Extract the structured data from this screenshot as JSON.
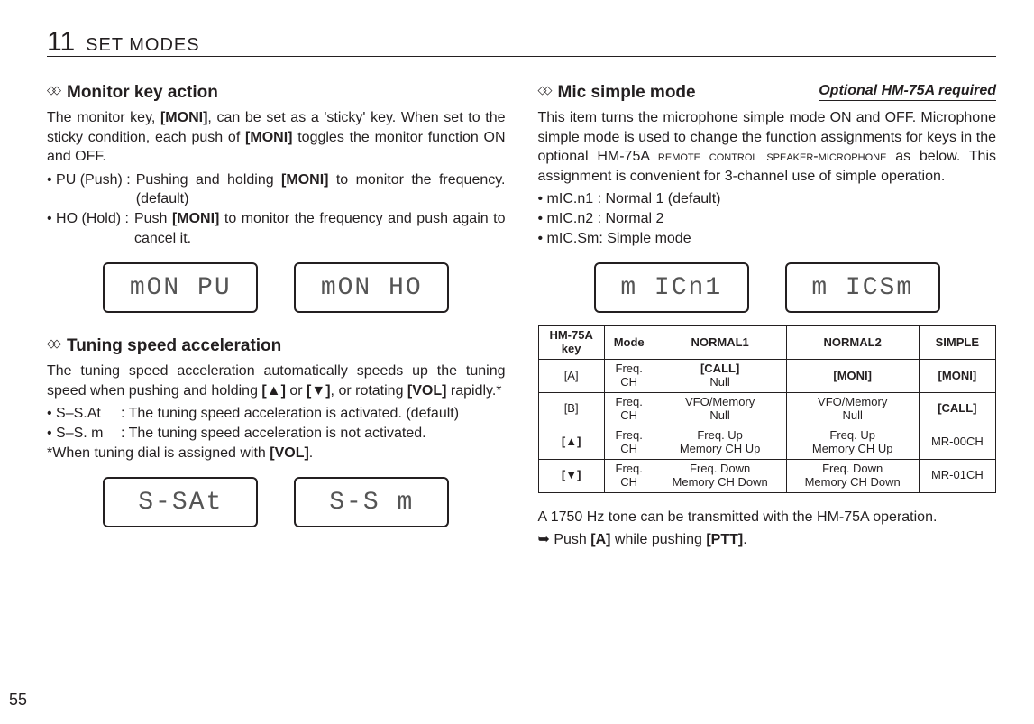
{
  "header": {
    "secnum": "11",
    "sectitle": "SET MODES"
  },
  "page_number": "55",
  "left": {
    "s1": {
      "diamond": "◇◇",
      "title": "Monitor key action",
      "p1a": "The monitor key, ",
      "p1b": "[MONI]",
      "p1c": ", can be set as a 'sticky' key. When set to the sticky condition, each push of ",
      "p1d": "[MONI]",
      "p1e": " toggles the monitor function ON and OFF.",
      "b1k": "• PU (Push) :",
      "b1va": "Pushing and holding ",
      "b1vb": "[MONI]",
      "b1vc": " to monitor the frequency. (default)",
      "b2k": "• HO (Hold) :",
      "b2va": "Push ",
      "b2vb": "[MONI]",
      "b2vc": " to monitor the frequency and push again to cancel it.",
      "lcd1": "mON PU",
      "lcd2": "mON HO"
    },
    "s2": {
      "diamond": "◇◇",
      "title": "Tuning speed acceleration",
      "p1a": "The tuning speed acceleration automatically speeds up the tuning speed when pushing and holding ",
      "p1b": "[▲]",
      "p1c": " or ",
      "p1d": "[▼]",
      "p1e": ", or rotating ",
      "p1f": "[VOL]",
      "p1g": " rapidly.*",
      "b1k": "• S–S.At",
      "b1v": ": The tuning speed acceleration is activated. (default)",
      "b2k": "• S–S. m",
      "b2v": ": The tuning speed acceleration is not activated.",
      "note_a": "*When tuning dial is assigned with ",
      "note_b": "[VOL]",
      "note_c": ".",
      "lcd1": "S-SAt",
      "lcd2": "S-S m"
    }
  },
  "right": {
    "s1": {
      "diamond": "◇◇",
      "title": "Mic simple mode",
      "rightnote": "Optional HM-75A required",
      "p1a": "This item turns the microphone simple mode ON and OFF. Microphone simple mode is used to change the function assignments for keys in the optional HM-75A ",
      "p1b": "remote control speaker-microphone",
      "p1c": " as below. This assignment is convenient for 3-channel use of simple operation.",
      "b1": "• mIC.n1 : Normal 1 (default)",
      "b2": "• mIC.n2 : Normal 2",
      "b3": "• mIC.Sm: Simple mode",
      "lcd1": "m ICn1",
      "lcd2": "m ICSm"
    },
    "table": {
      "h_key1": "HM-75A",
      "h_key2": "key",
      "h_mode": "Mode",
      "h_n1": "NORMAL1",
      "h_n2": "NORMAL2",
      "h_sm": "SIMPLE",
      "rows": [
        {
          "k": "[A]",
          "m1": "Freq.",
          "m2": "CH",
          "n1a": "[CALL]",
          "n1b": "Null",
          "n2": "[MONI]",
          "sm": "[MONI]"
        },
        {
          "k": "[B]",
          "m1": "Freq.",
          "m2": "CH",
          "n1a": "VFO/Memory",
          "n1b": "Null",
          "n2a": "VFO/Memory",
          "n2b": "Null",
          "sm": "[CALL]"
        },
        {
          "k": "[▲]",
          "m1": "Freq.",
          "m2": "CH",
          "n1a": "Freq. Up",
          "n1b": "Memory CH Up",
          "n2a": "Freq. Up",
          "n2b": "Memory CH Up",
          "sm": "MR-00CH"
        },
        {
          "k": "[▼]",
          "m1": "Freq.",
          "m2": "CH",
          "n1a": "Freq. Down",
          "n1b": "Memory CH Down",
          "n2a": "Freq. Down",
          "n2b": "Memory CH Down",
          "sm": "MR-01CH"
        }
      ]
    },
    "footer": {
      "p1": "A 1750 Hz tone can be transmitted with the HM-75A operation.",
      "p2a": "➥ Push ",
      "p2b": "[A]",
      "p2c": " while pushing ",
      "p2d": "[PTT]",
      "p2e": "."
    }
  }
}
